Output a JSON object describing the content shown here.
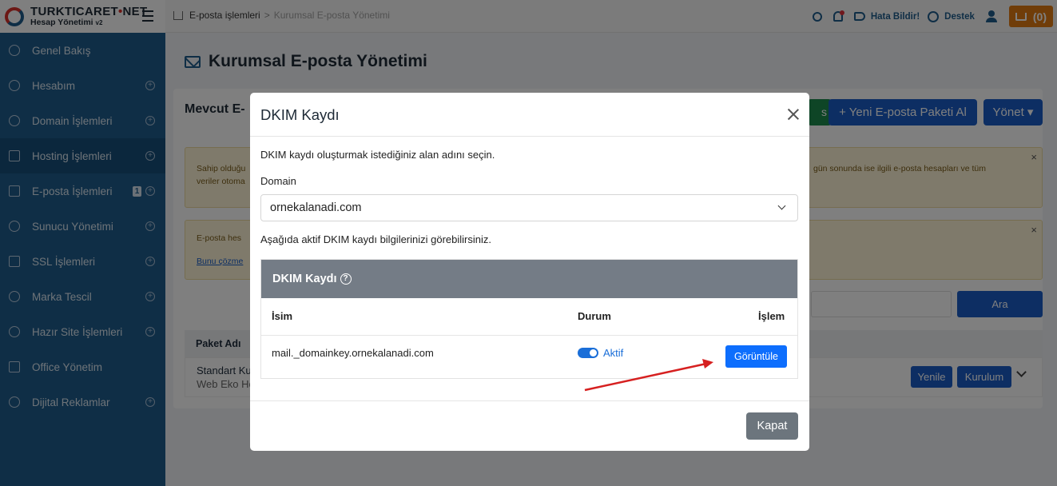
{
  "brand": {
    "name_a": "TURKTICARET",
    "name_dot": "•",
    "name_b": "NET",
    "sub": "Hesap Yönetimi",
    "version": "v2"
  },
  "sidebar": {
    "items": [
      {
        "label": "Genel Bakış"
      },
      {
        "label": "Hesabım"
      },
      {
        "label": "Domain İşlemleri"
      },
      {
        "label": "Hosting İşlemleri"
      },
      {
        "label": "E-posta İşlemleri",
        "badge": "1"
      },
      {
        "label": "Sunucu Yönetimi"
      },
      {
        "label": "SSL İşlemleri"
      },
      {
        "label": "Marka Tescil"
      },
      {
        "label": "Hazır Site İşlemleri"
      },
      {
        "label": "Office Yönetim"
      },
      {
        "label": "Dijital Reklamlar"
      }
    ]
  },
  "topbar": {
    "crumbs": [
      "E-posta işlemleri",
      "Kurumsal E-posta Yönetimi"
    ],
    "separator": ">",
    "report_label": "Hata Bildir!",
    "support_label": "Destek",
    "cart_label": "(0)"
  },
  "main": {
    "title": "Kurumsal E-posta Yönetimi",
    "card_head": "Mevcut E-",
    "green_btn_tail": "s",
    "new_package_label": "+ Yeni E-posta Paketi Al",
    "manage_label": "Yönet ▾",
    "alert1_left": "Sahip olduğu",
    "alert1_left2": "veriler otoma",
    "alert1_right": "gün sonunda ise ilgili e-posta hesapları ve tüm",
    "alert2_left": "E-posta hes",
    "alert2_link": "Bunu çözme",
    "search_label": "Ara",
    "table_header": "Paket Adı",
    "row_line1": "Standart Ku",
    "row_line2": "Web Eko Ho",
    "renew_label": "Yenile",
    "setup_label": "Kurulum"
  },
  "modal": {
    "title": "DKIM Kaydı",
    "intro": "DKIM kaydı oluşturmak istediğiniz alan adını seçin.",
    "domain_label": "Domain",
    "domain_value": "ornekalanadi.com",
    "info": "Aşağıda aktif DKIM kaydı bilgilerinizi görebilirsiniz.",
    "box_title": "DKIM Kaydı",
    "help_glyph": "?",
    "col_name": "İsim",
    "col_status": "Durum",
    "col_action": "İşlem",
    "record_name": "mail._domainkey.ornekalanadi.com",
    "record_status": "Aktif",
    "view_label": "Görüntüle",
    "close_label": "Kapat"
  },
  "colors": {
    "sidebar": "#1f5d8c",
    "primary": "#0d6efd",
    "cart": "#e07b12",
    "arrow": "#d62020"
  }
}
